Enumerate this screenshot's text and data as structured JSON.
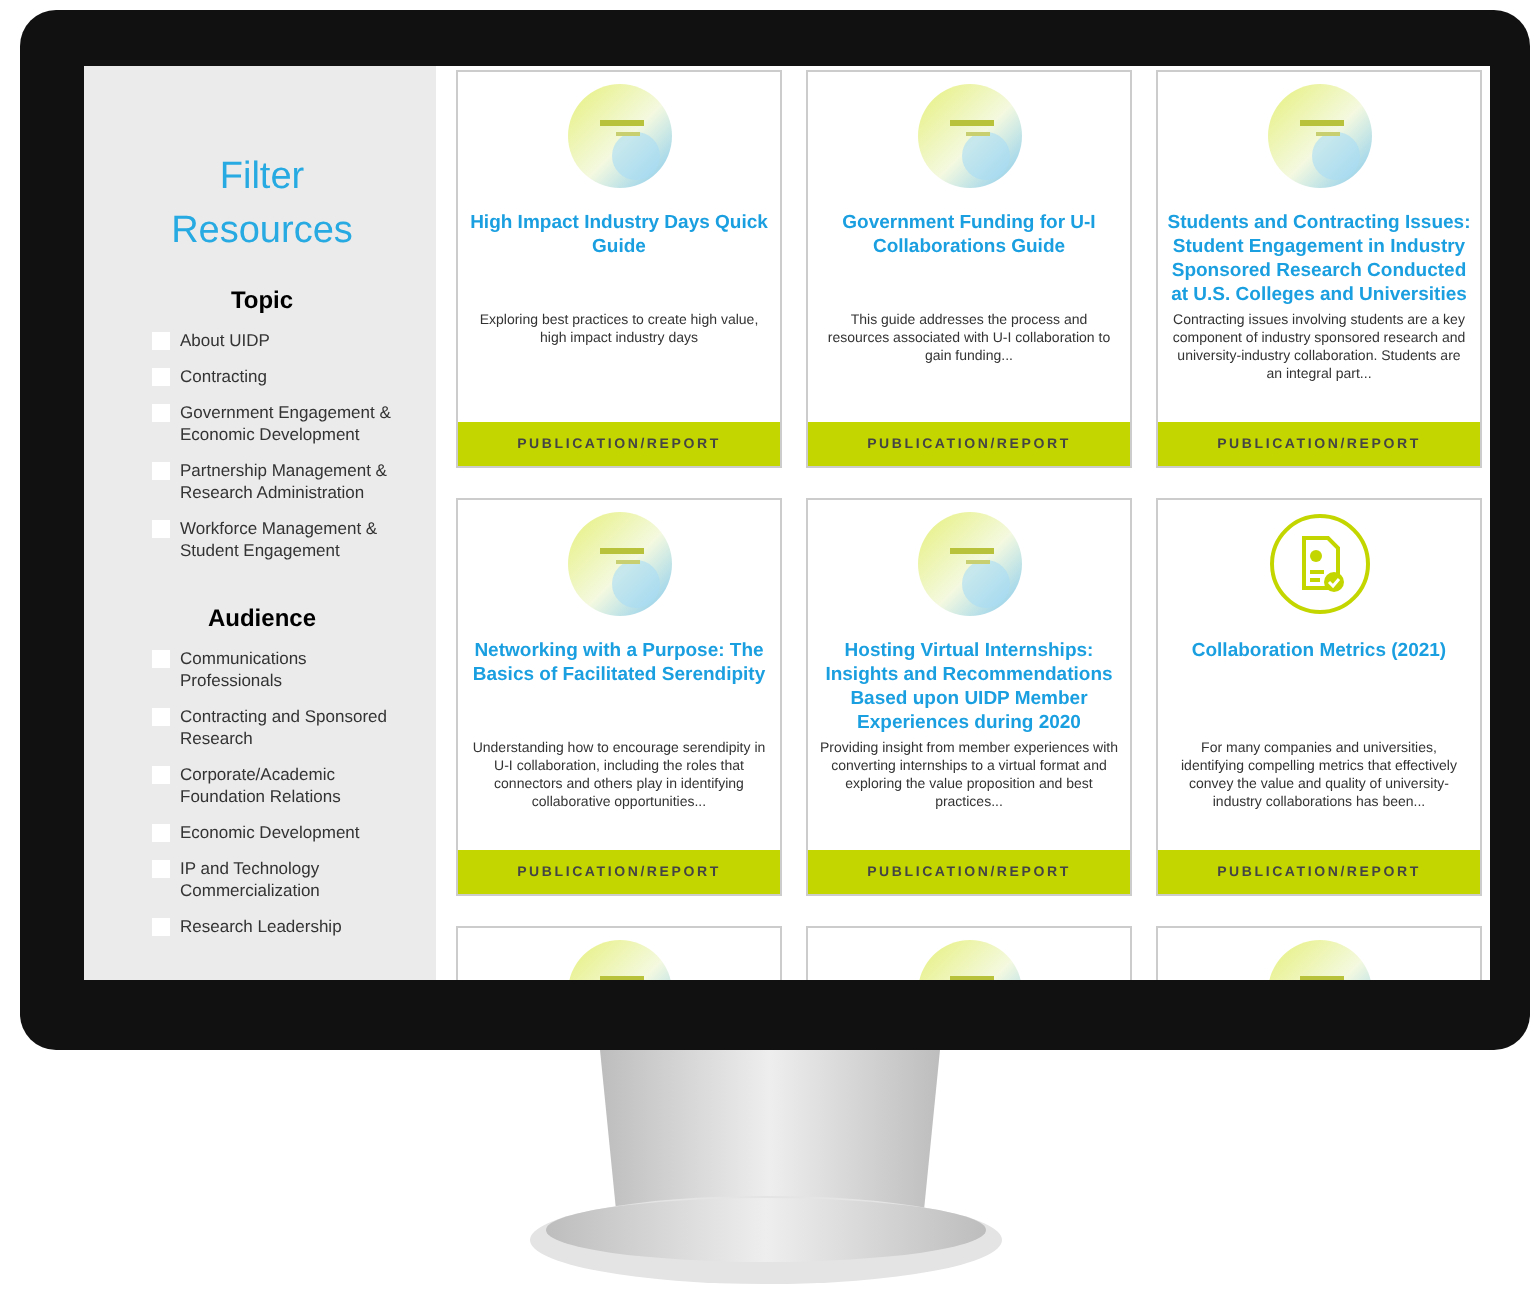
{
  "sidebar": {
    "title": "Filter Resources",
    "groups": [
      {
        "heading": "Topic",
        "options": [
          {
            "label": "About UIDP",
            "checked": false
          },
          {
            "label": "Contracting",
            "checked": false
          },
          {
            "label": "Government Engagement & Economic Development",
            "checked": false
          },
          {
            "label": "Partnership Management & Research Administration",
            "checked": false
          },
          {
            "label": "Workforce Management & Student Engagement",
            "checked": false
          }
        ]
      },
      {
        "heading": "Audience",
        "options": [
          {
            "label": "Communications Professionals",
            "checked": false
          },
          {
            "label": "Contracting and Sponsored Research",
            "checked": false
          },
          {
            "label": "Corporate/Academic Foundation Relations",
            "checked": false
          },
          {
            "label": "Economic Development",
            "checked": false
          },
          {
            "label": "IP and Technology Commercialization",
            "checked": false
          },
          {
            "label": "Research Leadership",
            "checked": false
          }
        ]
      }
    ]
  },
  "cards": [
    {
      "kind": "picture",
      "title": "High Impact Industry Days Quick Guide",
      "description": "Exploring best practices to create high value, high impact industry days",
      "type": "PUBLICATION/REPORT"
    },
    {
      "kind": "picture",
      "title": "Government Funding for U-I Collaborations Guide",
      "description": "This guide addresses the process and resources associated with U-I collaboration to gain funding...",
      "type": "PUBLICATION/REPORT"
    },
    {
      "kind": "picture",
      "title": "Students and Contracting Issues: Student Engagement in Industry Sponsored Research Conducted at U.S. Colleges and Universities",
      "description": "Contracting issues involving students are a key component of industry sponsored research and university-industry collaboration. Students are an integral part...",
      "type": "PUBLICATION/REPORT"
    },
    {
      "kind": "picture",
      "title": "Networking with a Purpose: The Basics of Facilitated Serendipity",
      "description": "Understanding how to encourage serendipity in U-I collaboration, including the roles that connectors and others play in identifying collaborative opportunities...",
      "type": "PUBLICATION/REPORT"
    },
    {
      "kind": "picture",
      "title": "Hosting Virtual Internships: Insights and Recommendations Based upon UIDP Member Experiences during 2020",
      "description": "Providing insight from member experiences with converting internships to a virtual format and exploring the value proposition and best practices...",
      "type": "PUBLICATION/REPORT"
    },
    {
      "kind": "icon",
      "title": "Collaboration Metrics (2021)",
      "description": "For many companies and universities, identifying compelling metrics that effectively convey the value and quality of university-industry collaborations has been...",
      "type": "PUBLICATION/REPORT"
    },
    {
      "kind": "picture"
    },
    {
      "kind": "picture"
    },
    {
      "kind": "picture"
    }
  ]
}
